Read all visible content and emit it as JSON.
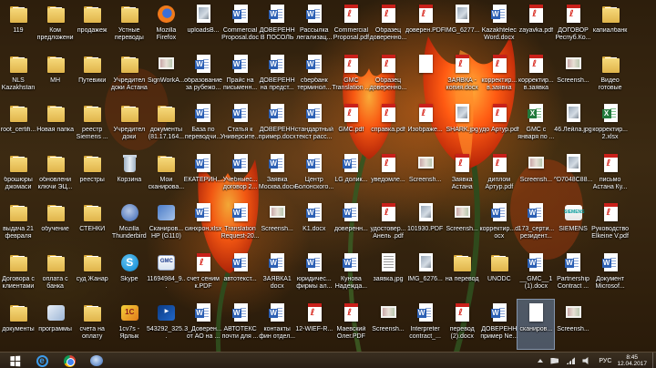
{
  "desktop": {
    "icons": [
      {
        "col": 0,
        "row": 0,
        "type": "folder",
        "label": "119"
      },
      {
        "col": 1,
        "row": 0,
        "type": "folder",
        "label": "Ком предложени"
      },
      {
        "col": 2,
        "row": 0,
        "type": "folder",
        "label": "продажеж"
      },
      {
        "col": 3,
        "row": 0,
        "type": "folder",
        "label": "Устные переводы"
      },
      {
        "col": 4,
        "row": 0,
        "type": "firefox",
        "label": "Mozilla Firefox"
      },
      {
        "col": 5,
        "row": 0,
        "type": "img",
        "label": "uploadsB..."
      },
      {
        "col": 6,
        "row": 0,
        "type": "doc",
        "label": "Commercial Proposal.doc"
      },
      {
        "col": 7,
        "row": 0,
        "type": "doc",
        "label": "ДОВЕРЕНН В ПОСОЛЬ"
      },
      {
        "col": 8,
        "row": 0,
        "type": "doc",
        "label": "Рассылка легализац..."
      },
      {
        "col": 9,
        "row": 0,
        "type": "pdf",
        "label": "Commercial Proposal.pdf"
      },
      {
        "col": 10,
        "row": 0,
        "type": "pdf",
        "label": "Образец доверенно..."
      },
      {
        "col": 11,
        "row": 0,
        "type": "pdf",
        "label": "доверен.PDF"
      },
      {
        "col": 12,
        "row": 0,
        "type": "img",
        "label": "IMG_6277..."
      },
      {
        "col": 13,
        "row": 0,
        "type": "doc",
        "label": "Kazakhtelec Word.docx"
      },
      {
        "col": 14,
        "row": 0,
        "type": "pdf",
        "label": "zayavka.pdf"
      },
      {
        "col": 15,
        "row": 0,
        "type": "pdf",
        "label": "ДОГОВОР Респуб.Ко..."
      },
      {
        "col": 16,
        "row": 0,
        "type": "folder",
        "label": "капиалбанк"
      },
      {
        "col": 0,
        "row": 1,
        "type": "folder",
        "label": "NLS Kazakhstan"
      },
      {
        "col": 1,
        "row": 1,
        "type": "folder",
        "label": "МН"
      },
      {
        "col": 2,
        "row": 1,
        "type": "folder",
        "label": "Путевики"
      },
      {
        "col": 3,
        "row": 1,
        "type": "folder",
        "label": "Учредител доки Астана"
      },
      {
        "col": 4,
        "row": 1,
        "type": "scan",
        "label": "SignWorkA..."
      },
      {
        "col": 5,
        "row": 1,
        "type": "doc",
        "label": "образование за рубежо..."
      },
      {
        "col": 6,
        "row": 1,
        "type": "doc",
        "label": "Прайс на письменн..."
      },
      {
        "col": 7,
        "row": 1,
        "type": "doc",
        "label": "ДОВЕРЕНН на предст..."
      },
      {
        "col": 8,
        "row": 1,
        "type": "doc",
        "label": "сбербанк терминол..."
      },
      {
        "col": 9,
        "row": 1,
        "type": "pdf",
        "label": "GMC Translation ..."
      },
      {
        "col": 10,
        "row": 1,
        "type": "pdf",
        "label": "Образец доверенно..."
      },
      {
        "col": 11,
        "row": 1,
        "type": "blank",
        "label": ""
      },
      {
        "col": 12,
        "row": 1,
        "type": "pdf",
        "label": "ЗАЯВКА - копия.docx"
      },
      {
        "col": 13,
        "row": 1,
        "type": "pdf",
        "label": "корректир... в.заявка"
      },
      {
        "col": 14,
        "row": 1,
        "type": "pdf",
        "label": "корректир... в.заявка"
      },
      {
        "col": 15,
        "row": 1,
        "type": "scan",
        "label": "Screensh..."
      },
      {
        "col": 16,
        "row": 1,
        "type": "folder",
        "label": "Видео готовые"
      },
      {
        "col": 0,
        "row": 2,
        "type": "folder",
        "label": "root_certifi..."
      },
      {
        "col": 1,
        "row": 2,
        "type": "folder",
        "label": "Новая папка"
      },
      {
        "col": 2,
        "row": 2,
        "type": "folder",
        "label": "реестр Siemens ..."
      },
      {
        "col": 3,
        "row": 2,
        "type": "folder",
        "label": "Учредител доки"
      },
      {
        "col": 4,
        "row": 2,
        "type": "folder",
        "label": "документы (81.17.164..."
      },
      {
        "col": 5,
        "row": 2,
        "type": "doc",
        "label": "База по переводчи..."
      },
      {
        "col": 6,
        "row": 2,
        "type": "doc",
        "label": "Статья к Университе..."
      },
      {
        "col": 7,
        "row": 2,
        "type": "doc",
        "label": "ДОВЕРЕНН пример.docx"
      },
      {
        "col": 8,
        "row": 2,
        "type": "doc",
        "label": "стандартный текст расс..."
      },
      {
        "col": 9,
        "row": 2,
        "type": "pdf",
        "label": "GMC.pdf"
      },
      {
        "col": 10,
        "row": 2,
        "type": "pdf",
        "label": "справка.pdf"
      },
      {
        "col": 11,
        "row": 2,
        "type": "pdf",
        "label": "Изображе..."
      },
      {
        "col": 12,
        "row": 2,
        "type": "img",
        "label": "SHARK.jpg"
      },
      {
        "col": 13,
        "row": 2,
        "type": "pdf",
        "label": "удо Артур.pdf"
      },
      {
        "col": 14,
        "row": 2,
        "type": "xls",
        "label": "GMC с января по ..."
      },
      {
        "col": 15,
        "row": 2,
        "type": "img",
        "label": "46.Лейла.jpg"
      },
      {
        "col": 16,
        "row": 2,
        "type": "xls",
        "label": "корректир... 2.xlsx"
      },
      {
        "col": 0,
        "row": 3,
        "type": "folder",
        "label": "брошюры джомаси"
      },
      {
        "col": 1,
        "row": 3,
        "type": "folder",
        "label": "обновлени ключи ЭЦ..."
      },
      {
        "col": 2,
        "row": 3,
        "type": "folder",
        "label": "реестры"
      },
      {
        "col": 3,
        "row": 3,
        "type": "bin",
        "label": "Корзина"
      },
      {
        "col": 4,
        "row": 3,
        "type": "folder",
        "label": "Мои сканирова..."
      },
      {
        "col": 5,
        "row": 3,
        "type": "doc",
        "label": "ЕКАТЕРИН..."
      },
      {
        "col": 6,
        "row": 3,
        "type": "doc",
        "label": "Учебныес... договор 2..."
      },
      {
        "col": 7,
        "row": 3,
        "type": "doc",
        "label": "Заявка Москва.docx"
      },
      {
        "col": 8,
        "row": 3,
        "type": "doc",
        "label": "Центр Болонского..."
      },
      {
        "col": 9,
        "row": 3,
        "type": "doc",
        "label": "LG долик..."
      },
      {
        "col": 10,
        "row": 3,
        "type": "pdf",
        "label": "уведомле..."
      },
      {
        "col": 11,
        "row": 3,
        "type": "scan",
        "label": "Screensh..."
      },
      {
        "col": 12,
        "row": 3,
        "type": "pdf",
        "label": "Заявка Астана"
      },
      {
        "col": 13,
        "row": 3,
        "type": "pdf",
        "label": "диплом Артур.pdf"
      },
      {
        "col": 14,
        "row": 3,
        "type": "scan",
        "label": "Screensh..."
      },
      {
        "col": 15,
        "row": 3,
        "type": "img",
        "label": "^D7048C88..."
      },
      {
        "col": 16,
        "row": 3,
        "type": "pdf",
        "label": "письмо Астана Ку..."
      },
      {
        "col": 0,
        "row": 4,
        "type": "folder",
        "label": "выдача 21 февраля"
      },
      {
        "col": 1,
        "row": 4,
        "type": "folder",
        "label": "обучение"
      },
      {
        "col": 2,
        "row": 4,
        "type": "folder",
        "label": "СТЕНКИ"
      },
      {
        "col": 3,
        "row": 4,
        "type": "thunder",
        "label": "Mozilla Thunderbird"
      },
      {
        "col": 4,
        "row": 4,
        "type": "shortcut",
        "label": "Сканиров... HP (G110)"
      },
      {
        "col": 5,
        "row": 4,
        "type": "doc",
        "label": "синхрон.xlsx"
      },
      {
        "col": 6,
        "row": 4,
        "type": "doc",
        "label": "Translation Request-20..."
      },
      {
        "col": 7,
        "row": 4,
        "type": "scan",
        "label": "Screensh..."
      },
      {
        "col": 8,
        "row": 4,
        "type": "doc",
        "label": "K1.docx"
      },
      {
        "col": 9,
        "row": 4,
        "type": "doc",
        "label": "доверенн..."
      },
      {
        "col": 10,
        "row": 4,
        "type": "pdf",
        "label": "удостовер... Анель .pdf"
      },
      {
        "col": 11,
        "row": 4,
        "type": "img",
        "label": "101930.PDF"
      },
      {
        "col": 12,
        "row": 4,
        "type": "scan",
        "label": "Screensh..."
      },
      {
        "col": 13,
        "row": 4,
        "type": "doc",
        "label": "корректир...docx"
      },
      {
        "col": 14,
        "row": 4,
        "type": "doc",
        "label": "173_серти... резидент..."
      },
      {
        "col": 15,
        "row": 4,
        "type": "siemens",
        "label": "SIEMENS"
      },
      {
        "col": 16,
        "row": 4,
        "type": "pdf",
        "label": "Руководство Elkeine V.pdf"
      },
      {
        "col": 0,
        "row": 5,
        "type": "folder",
        "label": "Договора с клиентами"
      },
      {
        "col": 1,
        "row": 5,
        "type": "folder",
        "label": "оплата с банка"
      },
      {
        "col": 2,
        "row": 5,
        "type": "folder",
        "label": "суд Жанар"
      },
      {
        "col": 3,
        "row": 5,
        "type": "skype",
        "label": "Skype"
      },
      {
        "col": 4,
        "row": 5,
        "type": "gmc",
        "label": "11694984_9..."
      },
      {
        "col": 5,
        "row": 5,
        "type": "pdf",
        "label": "счет сеним к.PDF"
      },
      {
        "col": 6,
        "row": 5,
        "type": "doc",
        "label": "автотекст..."
      },
      {
        "col": 7,
        "row": 5,
        "type": "doc",
        "label": "ЗАЯВКА1 docx"
      },
      {
        "col": 8,
        "row": 5,
        "type": "doc",
        "label": "юридичес... фирмы ал..."
      },
      {
        "col": 9,
        "row": 5,
        "type": "doc",
        "label": "Кунова Надежда..."
      },
      {
        "col": 10,
        "row": 5,
        "type": "txt",
        "label": "заявка.jpg"
      },
      {
        "col": 11,
        "row": 5,
        "type": "img",
        "label": "IMG_6276..."
      },
      {
        "col": 12,
        "row": 5,
        "type": "folder",
        "label": "на перевод"
      },
      {
        "col": 13,
        "row": 5,
        "type": "folder",
        "label": "UNODC"
      },
      {
        "col": 14,
        "row": 5,
        "type": "doc",
        "label": "__GMC__1 (1).docx"
      },
      {
        "col": 15,
        "row": 5,
        "type": "doc",
        "label": "Partnership Contract ..."
      },
      {
        "col": 16,
        "row": 5,
        "type": "doc",
        "label": "Документ Microsof..."
      },
      {
        "col": 0,
        "row": 6,
        "type": "folder",
        "label": "документы"
      },
      {
        "col": 1,
        "row": 6,
        "type": "prog",
        "label": "программы"
      },
      {
        "col": 2,
        "row": 6,
        "type": "folder",
        "label": "счета на оплату"
      },
      {
        "col": 3,
        "row": 6,
        "type": "1cv",
        "label": "1cv7s - Ярлык"
      },
      {
        "col": 4,
        "row": 6,
        "type": "blue",
        "label": "543292_325..."
      },
      {
        "col": 5,
        "row": 6,
        "type": "doc",
        "label": "3_Доверен... от АО на ..."
      },
      {
        "col": 6,
        "row": 6,
        "type": "doc",
        "label": "АВТОТЕКС почти для ..."
      },
      {
        "col": 7,
        "row": 6,
        "type": "doc",
        "label": "контакты фин отдел..."
      },
      {
        "col": 8,
        "row": 6,
        "type": "pdf",
        "label": "12-WIEF-R..."
      },
      {
        "col": 9,
        "row": 6,
        "type": "pdf",
        "label": "Маевский Олег.PDF"
      },
      {
        "col": 10,
        "row": 6,
        "type": "scan",
        "label": "Screensh..."
      },
      {
        "col": 11,
        "row": 6,
        "type": "doc",
        "label": "Interpreter contract_..."
      },
      {
        "col": 12,
        "row": 6,
        "type": "pdf",
        "label": "перевод (2).docx"
      },
      {
        "col": 13,
        "row": 6,
        "type": "doc",
        "label": "ДОВЕРЕНН пример Ne..."
      },
      {
        "col": 14,
        "row": 6,
        "type": "blank",
        "label": "сканиров...",
        "selected": true
      },
      {
        "col": 15,
        "row": 6,
        "type": "scan",
        "label": "Screensh..."
      }
    ]
  },
  "taskbar": {
    "language": "РУС",
    "time": "8:45",
    "date": "12.04.2017"
  }
}
